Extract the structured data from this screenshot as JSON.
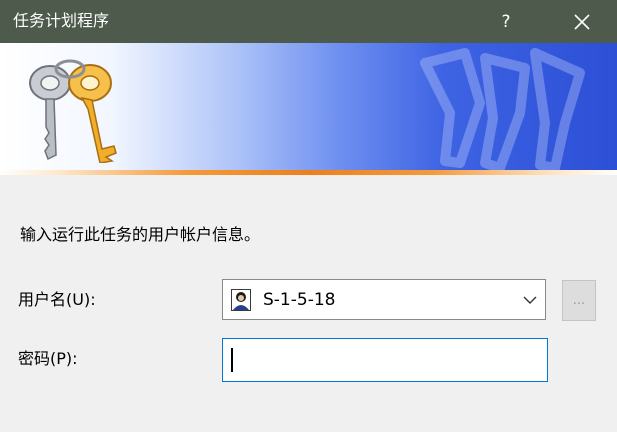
{
  "window": {
    "title": "任务计划程序",
    "help_label": "?",
    "close_label": "close"
  },
  "banner": {
    "icon": "keys-icon",
    "watermark": "keys-watermark-icon"
  },
  "form": {
    "instruction": "输入运行此任务的用户帐户信息。",
    "username_label": "用户名(U):",
    "username_value": "S-1-5-18",
    "username_icon": "user-account-icon",
    "browse_label": "...",
    "password_label": "密码(P):",
    "password_value": ""
  },
  "colors": {
    "titlebar": "#4d5a4c",
    "accent_blue": "#0078d7",
    "banner_blue": "#2c4fd6",
    "banner_orange": "#ee7f1d"
  }
}
